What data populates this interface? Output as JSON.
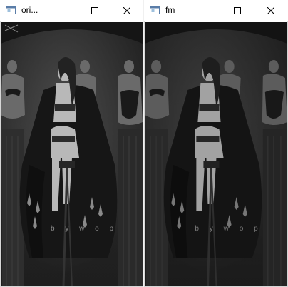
{
  "windows": [
    {
      "title": "ori...",
      "icon": "app-window-icon",
      "controls": [
        "minimize-icon",
        "maximize-icon",
        "close-icon"
      ],
      "content": "original image (grayscale photo)"
    },
    {
      "title": "fm",
      "icon": "app-window-icon",
      "controls": [
        "minimize-icon",
        "maximize-icon",
        "close-icon"
      ],
      "content": "processed image (fm)"
    }
  ],
  "watermark": "b y w o p",
  "colors": {
    "titlebar_bg": "#ffffff",
    "titlebar_text": "#000000",
    "image_dark": "#1a1a1a"
  }
}
